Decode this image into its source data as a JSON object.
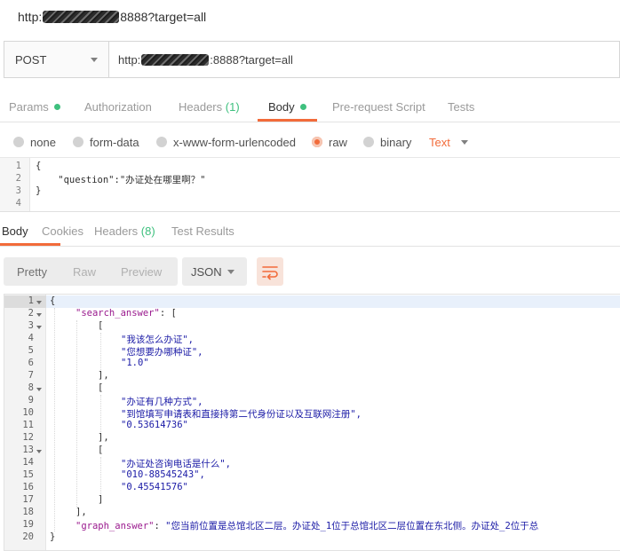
{
  "title_bar": {
    "url_prefix": "http:",
    "url_suffix": "8888?target=all"
  },
  "request": {
    "method": "POST",
    "url_prefix": "http:",
    "url_suffix": ":8888?target=all"
  },
  "request_tabs": {
    "params": "Params",
    "authorization": "Authorization",
    "headers": "Headers",
    "headers_count": "(1)",
    "body": "Body",
    "prerequest": "Pre-request Script",
    "tests": "Tests"
  },
  "body_types": {
    "none": "none",
    "form_data": "form-data",
    "urlencoded": "x-www-form-urlencoded",
    "raw": "raw",
    "binary": "binary",
    "text_type": "Text"
  },
  "request_body": {
    "lines": [
      "{",
      "    \"question\":\"办证处在哪里啊？\"",
      "}",
      ""
    ]
  },
  "response_tabs": {
    "body": "Body",
    "cookies": "Cookies",
    "headers": "Headers",
    "headers_count": "(8)",
    "test_results": "Test Results"
  },
  "response_toolbar": {
    "pretty": "Pretty",
    "raw": "Raw",
    "preview": "Preview",
    "format": "JSON"
  },
  "response_body": {
    "search_answer_key": "\"search_answer\"",
    "graph_answer_key": "\"graph_answer\"",
    "g1": [
      "\"我该怎么办证\",",
      "\"您想要办哪种证\",",
      "\"1.0\""
    ],
    "g2": [
      "\"办证有几种方式\",",
      "\"到馆填写申请表和直接持第二代身份证以及互联网注册\",",
      "\"0.53614736\""
    ],
    "g3": [
      "\"办证处咨询电话是什么\",",
      "\"010-88545243\",",
      "\"0.45541576\""
    ],
    "graph_answer_value": "\"您当前位置是总馆北区二层。办证处_1位于总馆北区二层位置在东北侧。办证处_2位于总"
  },
  "icons": {
    "wrap": "wrap-lines-icon",
    "dropdown": "chevron-down-icon"
  },
  "colors": {
    "accent": "#f26b3a",
    "green": "#3ec07e",
    "json_key": "#9a1a8e",
    "json_string": "#1a1aa6"
  }
}
